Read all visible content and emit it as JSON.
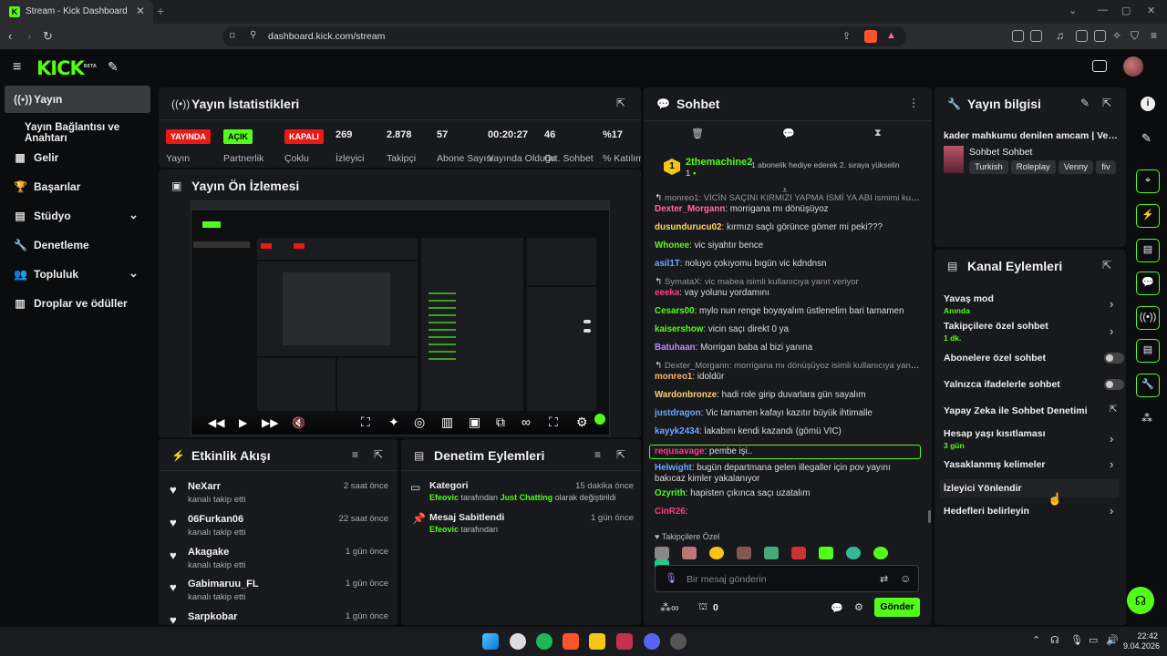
{
  "browser": {
    "tab_title": "Stream - Kick Dashboard",
    "url": "dashboard.kick.com/stream"
  },
  "app": {
    "logo": "KICK",
    "logo_tag": "BETA"
  },
  "sidebar": {
    "items": [
      {
        "label": "Yayın"
      },
      {
        "label": "Yayın Bağlantısı ve Anahtarı"
      },
      {
        "label": "Gelir"
      },
      {
        "label": "Başarılar"
      },
      {
        "label": "Stüdyo"
      },
      {
        "label": "Denetleme"
      },
      {
        "label": "Topluluk"
      },
      {
        "label": "Droplar ve ödüller"
      }
    ]
  },
  "stats": {
    "title": "Yayın İstatistikleri",
    "items": [
      {
        "value": "YAYINDA",
        "label": "Yayın"
      },
      {
        "value": "AÇIK",
        "label": "Partnerlik"
      },
      {
        "value": "KAPALI",
        "label": "Çoklu"
      },
      {
        "value": "269",
        "label": "İzleyici"
      },
      {
        "value": "2.878",
        "label": "Takipçi"
      },
      {
        "value": "57",
        "label": "Abone Sayısı"
      },
      {
        "value": "00:20:27",
        "label": "Yayında Olduğu"
      },
      {
        "value": "46",
        "label": "Ort. Sohbet"
      },
      {
        "value": "%17",
        "label": "% Katılım"
      }
    ]
  },
  "preview": {
    "title": "Yayın Ön İzlemesi"
  },
  "activity": {
    "title": "Etkinlik Akışı",
    "items": [
      {
        "name": "NeXarr",
        "sub": "kanalı takip etti",
        "time": "2 saat önce"
      },
      {
        "name": "06Furkan06",
        "sub": "kanalı takip etti",
        "time": "22 saat önce"
      },
      {
        "name": "Akagake",
        "sub": "kanalı takip etti",
        "time": "1 gün önce"
      },
      {
        "name": "Gabimaruu_FL",
        "sub": "kanalı takip etti",
        "time": "1 gün önce"
      },
      {
        "name": "Sarpkobar",
        "sub": "",
        "time": "1 gün önce"
      }
    ]
  },
  "moderation": {
    "title": "Denetim Eylemleri",
    "items": [
      {
        "title": "Kategori",
        "time": "15 dakika önce",
        "actor": "Efeovic",
        "pre": " tarafından ",
        "hl": "Just Chatting",
        "post": " olarak değiştirildi"
      },
      {
        "title": "Mesaj Sabitlendi",
        "time": "1 gün önce",
        "actor": "Efeovic",
        "pre": " tarafından",
        "hl": "",
        "post": ""
      }
    ]
  },
  "chat": {
    "title": "Sohbet",
    "gift_user": "2themachine2",
    "gift_count": "1",
    "gift_text": "1 abonelik hediye ederek 2. sıraya yükselin",
    "messages": [
      {
        "sys": "monreo1: VİCİN SAÇINI KIRMIZI YAPMA İSMİ YA ABI ismimi kullanıcıya ..."
      },
      {
        "user": "Dexter_Morgann",
        "color": "#ff6b9d",
        "text": "morrigana mı dönüşüyoz"
      },
      {
        "user": "dusundurucu02",
        "color": "#ffd36b",
        "text": "kırmızı saçlı görünce gömer mi peki???"
      },
      {
        "user": "Whonee",
        "color": "#53fc18",
        "text": "vic siyahtır bence"
      },
      {
        "user": "asil1T",
        "color": "#6ba7ff",
        "text": "noluyo çokıyomu bıgün vic kdndnsn"
      },
      {
        "sys": "SymataX: vic mabea isimli kullanıcıya yanıt veriyor"
      },
      {
        "user": "eeeka",
        "color": "#ff3d7f",
        "text": "vay yolunu yordamını"
      },
      {
        "user": "Cesars00",
        "color": "#53fc18",
        "text": "mylo nun renge boyayalım üstlenelim bari tamamen"
      },
      {
        "user": "kaisershow",
        "color": "#53fc18",
        "text": "vicin saçı direkt 0 ya"
      },
      {
        "user": "Batuhaan",
        "color": "#b98cff",
        "text": "Morrigan baba al bizi yanına"
      },
      {
        "sys": "Dexter_Morgann: morrigana mı dönüşüyoz isimli kullanıcıya yanıt veriyor"
      },
      {
        "user": "monreo1",
        "color": "#ffb36b",
        "text": "idoldür"
      },
      {
        "user": "Wardonbronze",
        "color": "#ffd36b",
        "text": "hadi role girip duvarlara gün sayalım"
      },
      {
        "user": "justdragon",
        "color": "#6ba7ff",
        "text": "Vic tamamen kafayı kazıtır büyük ihtimalle"
      },
      {
        "user": "kayyk2434",
        "color": "#6ba7ff",
        "text": "lakabını kendi kazandı (gömü VİC)"
      },
      {
        "user": "requsavage",
        "color": "#ff3d7f",
        "text": "pembe işi.."
      },
      {
        "user": "Helwight",
        "color": "#6ba7ff",
        "text": "bugün departmana gelen illegaller için pov yayını bakıcaz kimler yakalanıyor"
      },
      {
        "user": "Ozyrith",
        "color": "#53fc18",
        "text": "hapisten çıkınca saçı uzatalım"
      },
      {
        "user": "CinR26",
        "color": "#ff3d7f",
        "text": ""
      }
    ],
    "follower_only": "Takipçilere Özel",
    "input_placeholder": "Bir mesaj gönderin",
    "count": "0",
    "send_label": "Gönder"
  },
  "stream_info": {
    "title": "Yayın bilgisi",
    "stream_title": "kader mahkumu denilen amcam | Venny",
    "category": "Sohbet Sohbet",
    "tags": [
      "Turkish",
      "Roleplay",
      "Venny",
      "fiv"
    ]
  },
  "channel_actions": {
    "title": "Kanal Eylemleri",
    "items": [
      {
        "label": "Yavaş mod",
        "sub": "Anında",
        "kind": "chevron"
      },
      {
        "label": "Takipçilere özel sohbet",
        "sub": "1 dk.",
        "kind": "chevron"
      },
      {
        "label": "Abonelere özel sohbet",
        "sub": "",
        "kind": "toggle"
      },
      {
        "label": "Yalnızca ifadelerle sohbet",
        "sub": "",
        "kind": "toggle"
      },
      {
        "label": "Yapay Zeka ile Sohbet Denetimi",
        "sub": "",
        "kind": "external"
      },
      {
        "label": "Hesap yaşı kısıtlaması",
        "sub": "3 gün",
        "kind": "chevron"
      },
      {
        "label": "Yasaklanmış kelimeler",
        "sub": "",
        "kind": "chevron"
      },
      {
        "label": "İzleyici Yönlendir",
        "sub": "",
        "kind": "none"
      },
      {
        "label": "Hedefleri belirleyin",
        "sub": "",
        "kind": "chevron"
      }
    ]
  },
  "taskbar": {
    "time": "22:42",
    "date": "9.04.2026"
  },
  "colors": {
    "accent": "#53fc18",
    "live": "#e91916",
    "panel": "#18191c",
    "bg": "#0b0c0e"
  }
}
